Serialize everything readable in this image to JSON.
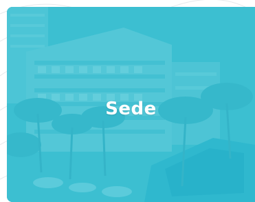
{
  "card": {
    "title": "Sede",
    "overlay_color": "#2ab3c8",
    "image": "hotel-building-pool-palm-trees"
  }
}
